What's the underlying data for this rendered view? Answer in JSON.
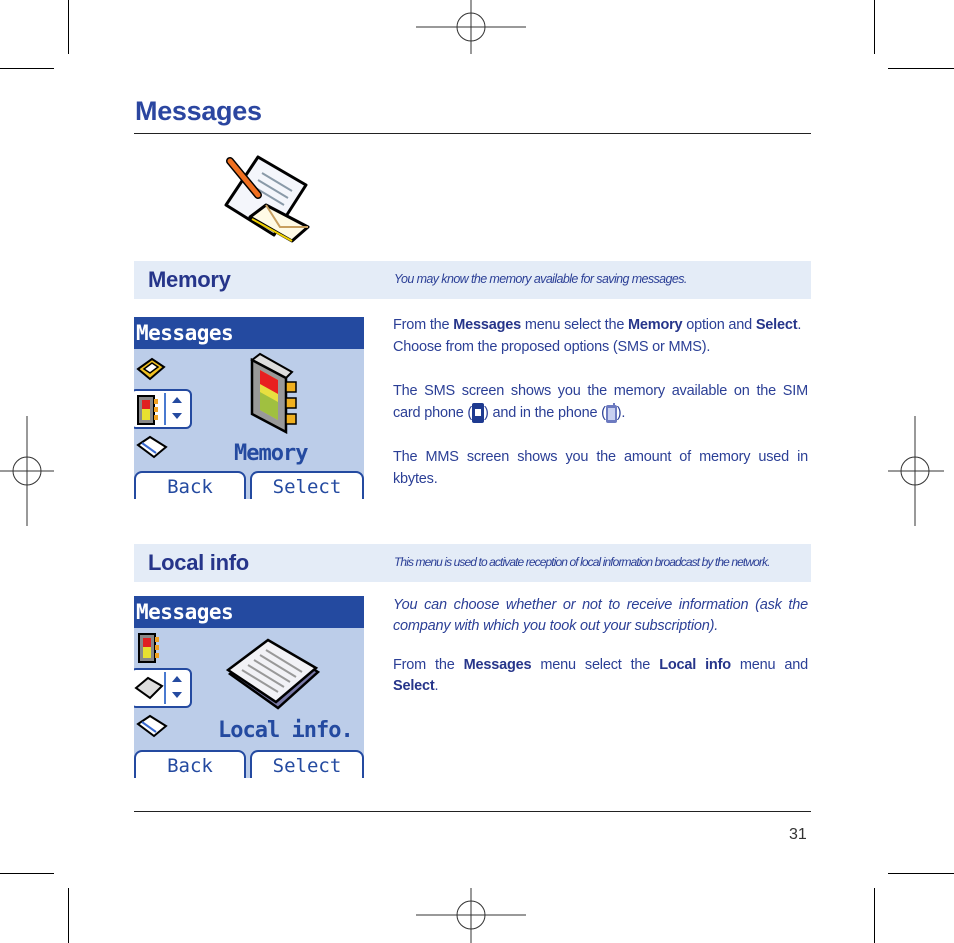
{
  "page": {
    "title": "Messages",
    "page_number": "31"
  },
  "header_icon": "messages-pencil-envelope-icon",
  "sections": [
    {
      "title": "Memory",
      "description": "You may know the memory available for saving messages.",
      "phone_screen": {
        "header": "Messages",
        "icons": [
          "card-icon",
          "memory-book-icon",
          "notepad-icon"
        ],
        "main_icon": "memory-book-icon",
        "label": "Memory",
        "left_softkey": "Back",
        "right_softkey": "Select"
      },
      "body": {
        "p1_a": "From the ",
        "p1_b": "Messages",
        "p1_c": " menu select the ",
        "p1_d": "Memory",
        "p1_e": " option and ",
        "p1_f": "Select",
        "p1_g": ".",
        "p2": "Choose from the proposed options (SMS or MMS).",
        "p3_a": "The SMS screen shows you the memory available on the SIM card phone (",
        "p3_b": ") and in the phone (",
        "p3_c": ").",
        "p4": "The MMS screen shows you the amount of memory used in kbytes."
      }
    },
    {
      "title": "Local info",
      "description": "This menu is used to activate reception of local information broadcast by the network.",
      "phone_screen": {
        "header": "Messages",
        "icons": [
          "memory-book-icon",
          "newspaper-icon",
          "notepad-icon"
        ],
        "main_icon": "newspaper-icon",
        "label": "Local info.",
        "left_softkey": "Back",
        "right_softkey": "Select"
      },
      "body": {
        "p1": "You can choose whether or not to receive information (ask the company with which you took out your subscription).",
        "p2_a": "From the ",
        "p2_b": "Messages",
        "p2_c": " menu select the ",
        "p2_d": "Local info",
        "p2_e": " menu and ",
        "p2_f": "Select",
        "p2_g": "."
      }
    }
  ],
  "colors": {
    "title_blue": "#2b46a0",
    "band_bg": "#e4ecf7",
    "screen_header": "#244aa0",
    "screen_bg": "#bccde9"
  }
}
